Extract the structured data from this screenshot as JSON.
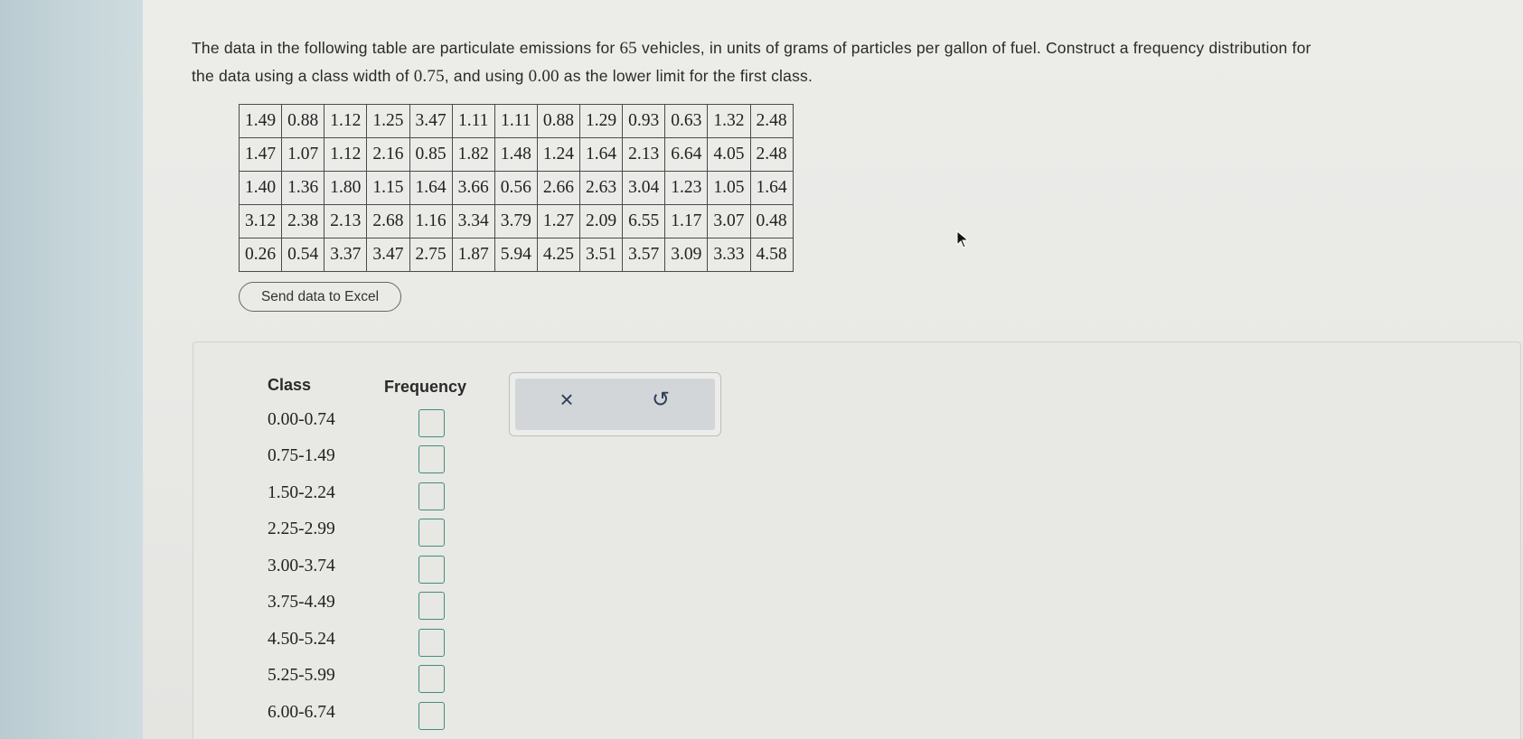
{
  "question": {
    "line1_pre": "The data in the following table are particulate emissions for ",
    "vehicles_count": "65",
    "line1_post": " vehicles, in units of grams of particles per gallon of fuel. Construct a frequency distribution for",
    "line2_pre": "the data using a class width of ",
    "class_width": "0.75",
    "line2_mid": ", and using ",
    "lower_limit": "0.00",
    "line2_post": " as the lower limit for the first class."
  },
  "data_table": [
    [
      "1.49",
      "0.88",
      "1.12",
      "1.25",
      "3.47",
      "1.11",
      "1.11",
      "0.88",
      "1.29",
      "0.93",
      "0.63",
      "1.32",
      "2.48"
    ],
    [
      "1.47",
      "1.07",
      "1.12",
      "2.16",
      "0.85",
      "1.82",
      "1.48",
      "1.24",
      "1.64",
      "2.13",
      "6.64",
      "4.05",
      "2.48"
    ],
    [
      "1.40",
      "1.36",
      "1.80",
      "1.15",
      "1.64",
      "3.66",
      "0.56",
      "2.66",
      "2.63",
      "3.04",
      "1.23",
      "1.05",
      "1.64"
    ],
    [
      "3.12",
      "2.38",
      "2.13",
      "2.68",
      "1.16",
      "3.34",
      "3.79",
      "1.27",
      "2.09",
      "6.55",
      "1.17",
      "3.07",
      "0.48"
    ],
    [
      "0.26",
      "0.54",
      "3.37",
      "3.47",
      "2.75",
      "1.87",
      "5.94",
      "4.25",
      "3.51",
      "3.57",
      "3.09",
      "3.33",
      "4.58"
    ]
  ],
  "excel_button": "Send data to Excel",
  "answer": {
    "class_header": "Class",
    "frequency_header": "Frequency",
    "classes": [
      "0.00-0.74",
      "0.75-1.49",
      "1.50-2.24",
      "2.25-2.99",
      "3.00-3.74",
      "3.75-4.49",
      "4.50-5.24",
      "5.25-5.99",
      "6.00-6.74"
    ],
    "frequencies": [
      "",
      "",
      "",
      "",
      "",
      "",
      "",
      "",
      ""
    ]
  },
  "tools": {
    "clear_icon": "close-icon",
    "reset_icon": "undo-icon",
    "clear_glyph": "×",
    "reset_glyph": "↺"
  },
  "colors": {
    "input_border": "#3f8f7f",
    "icon": "#2d3e5a"
  }
}
